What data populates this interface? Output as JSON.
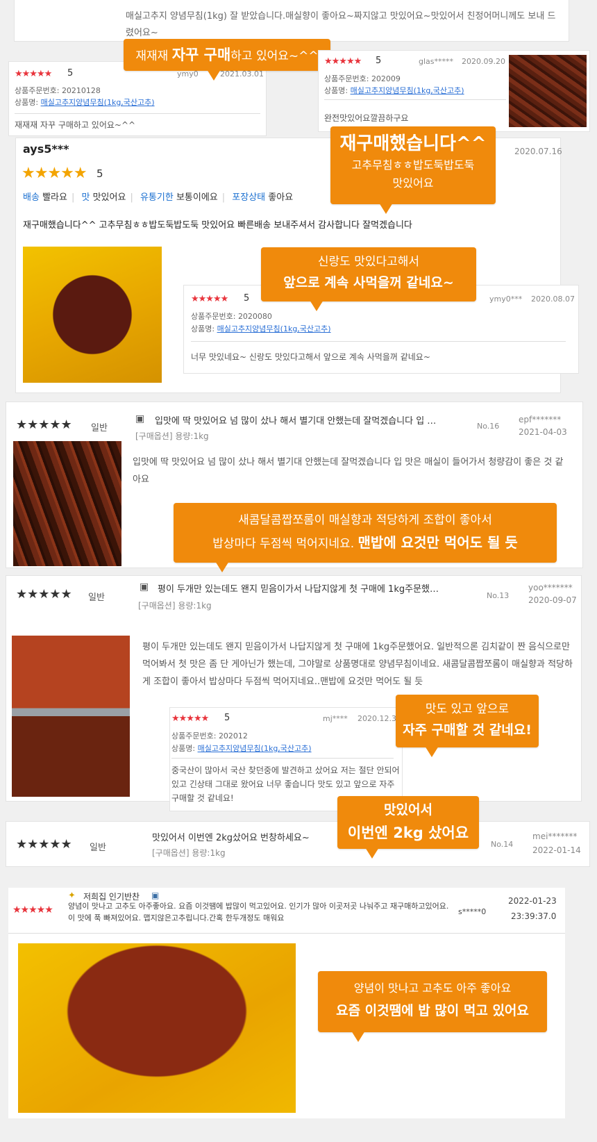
{
  "r0": {
    "text": "매실고추지 양념무침(1kg) 잘 받았습니다.매실향이 좋아요~짜지않고 맛있어요~맛있어서 친정어머니께도 보내 드렸어요~"
  },
  "r1": {
    "stars": "★★★★★",
    "score": "5",
    "user": "ymy0",
    "date": "2021.03.01",
    "order_label": "상품주문번호:",
    "order": "20210128",
    "product_label": "상품명:",
    "product": "매실고추지양념무침(1kg,국산고추)",
    "text": "재재재 자꾸 구매하고 있어요~^^"
  },
  "b1": {
    "pre": "재재재 ",
    "strong": "자꾸 구매",
    "post": "하고 있어요~^^"
  },
  "r2": {
    "stars": "★★★★★",
    "score": "5",
    "user": "glas*****",
    "date": "2020.09.20",
    "order_label": "상품주문번호:",
    "order": "202009",
    "product_label": "상품명:",
    "product": "매실고추지양념무침(1kg,국산고추)",
    "text": "완전맛있어요깔끔하구요"
  },
  "r3": {
    "user": "ays5***",
    "date": "2020.07.16",
    "stars": "★★★★★",
    "score": "5",
    "tags": [
      {
        "k": "배송",
        "v": "빨라요"
      },
      {
        "k": "맛",
        "v": "맛있어요"
      },
      {
        "k": "유통기한",
        "v": "보통이에요"
      },
      {
        "k": "포장상태",
        "v": "좋아요"
      }
    ],
    "text": "재구매했습니다^^ 고추무침ㅎㅎ밥도둑밥도둑 맛있어요 빠른배송 보내주셔서 감사합니다 잘먹겠습니다"
  },
  "b2": {
    "line1": "재구매했습니다^^",
    "line2": "고추무침ㅎㅎ밥도둑밥도둑",
    "line3": "맛있어요"
  },
  "r4": {
    "stars": "★★★★★",
    "score": "5",
    "user": "ymy0***",
    "date": "2020.08.07",
    "order_label": "상품주문번호:",
    "order": "2020080",
    "product_label": "상품명:",
    "product": "매실고추지양념무침(1kg,국산고추)",
    "text": "너무 맛있네요~ 신랑도 맛있다고해서 앞으로 계속 사먹을꺼 같네요~"
  },
  "b3": {
    "line1": "신랑도 맛있다고해서",
    "line2": "앞으로 계속 사먹을꺼 같네요~"
  },
  "r5": {
    "stars": "★★★★★",
    "grade": "일반",
    "title": "입맛에 딱 맛있어요 넘 많이 샀나 해서 별기대 안했는데 잘먹겠습니다 입 …",
    "option": "[구매옵션] 용량:1kg",
    "no": "No.16",
    "user": "epf*******",
    "date": "2021-04-03",
    "text": "입맛에 딱 맛있어요 넘 많이 샀나 해서 별기대 안했는데 잘먹겠습니다 입 맛은 매실이 들어가서 청량감이 좋은 것 같아요"
  },
  "b4": {
    "line1": "새콤달콤짭쪼롬이 매실향과 적당하게 조합이 좋아서",
    "line2a": "밥상마다 두점씩 먹어지네요. ",
    "line2b": "맨밥에 요것만 먹어도 될 듯"
  },
  "r6": {
    "stars": "★★★★★",
    "grade": "일반",
    "title": "평이 두개만 있는데도 왠지 믿음이가서 나답지않게 첫 구매에 1kg주문했…",
    "option": "[구매옵션] 용량:1kg",
    "no": "No.13",
    "user": "yoo*******",
    "date": "2020-09-07",
    "text": "평이 두개만 있는데도 왠지 믿음이가서 나답지않게 첫 구매에 1kg주문했어요. 일반적으론 김치같이 짠 음식으로만 먹어봐서 첫 맛은 좀 단 게아닌가 했는데, 그야말로 상품명대로 양념무침이네요. 새콤달콤짭쪼롬이 매실향과 적당하게 조합이 좋아서 밥상마다 두점씩 먹어지네요..맨밥에 요것만 먹어도 될 듯"
  },
  "r7": {
    "stars": "★★★★★",
    "score": "5",
    "user": "mj****",
    "date": "2020.12.3",
    "order_label": "상품주문번호:",
    "order": "202012",
    "product_label": "상품명:",
    "product": "매실고추지양념무침(1kg,국산고추)",
    "text": "중국산이 많아서 국산 찾던중에 발견하고 샀어요 저는 절단 안되어있고 긴상태 그대로 왔어요 너무 좋습니다 맛도 있고 앞으로 자주 구매할 것 같네요!"
  },
  "b5": {
    "line1": "맛도 있고 앞으로",
    "line2": "자주 구매할 것 같네요!"
  },
  "r8": {
    "stars": "★★★★★",
    "grade": "일반",
    "title": "맛있어서 이번엔 2kg샀어요 번창하세요~",
    "option": "[구매옵션] 용량:1kg",
    "no": "No.14",
    "user": "mei*******",
    "date": "2022-01-14"
  },
  "b6": {
    "line1": "맛있어서",
    "line2": "이번엔 2kg 샀어요"
  },
  "r9": {
    "badge": "저희집 인기반찬",
    "stars": "★★★★★",
    "text": "양념이 맛나고 고추도 아주좋아요. 요즘 이것땜에 밥많이 먹고있어요. 인기가 많아 이곳저곳 나눠주고 재구매하고있어요. 이 맛에 푹 빠져있어요. 맵지않은고추립니다.간혹 한두개정도 매워요",
    "user": "s*****0",
    "date": "2022-01-23",
    "time": "23:39:37.0"
  },
  "b7": {
    "line1": "양념이 맛나고 고추도 아주 좋아요",
    "line2": "요즘 이것땜에 밥 많이 먹고 있어요"
  },
  "colors": {
    "accent": "#f08a0c",
    "star_red": "#e8343c",
    "star_gold": "#f3a400",
    "link": "#2a6fd6"
  }
}
